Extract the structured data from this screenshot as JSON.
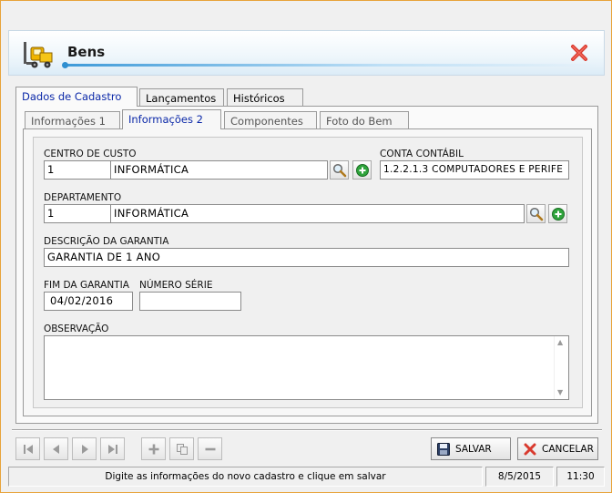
{
  "window": {
    "title": "Bens"
  },
  "tabs": [
    {
      "label": "Dados de Cadastro",
      "active": true
    },
    {
      "label": "Lançamentos",
      "active": false
    },
    {
      "label": "Históricos",
      "active": false
    }
  ],
  "subtabs": [
    {
      "label": "Informações 1",
      "active": false
    },
    {
      "label": "Informações 2",
      "active": true
    },
    {
      "label": "Componentes",
      "active": false
    },
    {
      "label": "Foto do Bem",
      "active": false
    }
  ],
  "form": {
    "centro_custo": {
      "label": "CENTRO DE CUSTO",
      "code": "1",
      "name": "INFORMÁTICA"
    },
    "conta_contabil": {
      "label": "CONTA CONTÁBIL",
      "value": "1.2.2.1.3 COMPUTADORES E PERIFE"
    },
    "departamento": {
      "label": "DEPARTAMENTO",
      "code": "1",
      "name": "INFORMÁTICA"
    },
    "descricao_garantia": {
      "label": "DESCRIÇÃO DA GARANTIA",
      "value": "GARANTIA DE 1 ANO"
    },
    "fim_garantia": {
      "label": "FIM DA GARANTIA",
      "value": "04/02/2016"
    },
    "numero_serie": {
      "label": "NÚMERO SÉRIE",
      "value": ""
    },
    "observacao": {
      "label": "OBSERVAÇÃO",
      "value": ""
    }
  },
  "toolbar": {
    "nav": [
      "first-icon",
      "prev-icon",
      "next-icon",
      "last-icon"
    ],
    "edit": [
      "add-icon",
      "copy-icon",
      "remove-icon"
    ],
    "save_label": "SALVAR",
    "cancel_label": "CANCELAR"
  },
  "status": {
    "message": "Digite as informações do novo cadastro e clique em salvar",
    "date": "8/5/2015",
    "time": "11:30"
  },
  "colors": {
    "accent": "#0b28a8",
    "close": "#d93a2e",
    "window_border": "#e8a33a"
  }
}
